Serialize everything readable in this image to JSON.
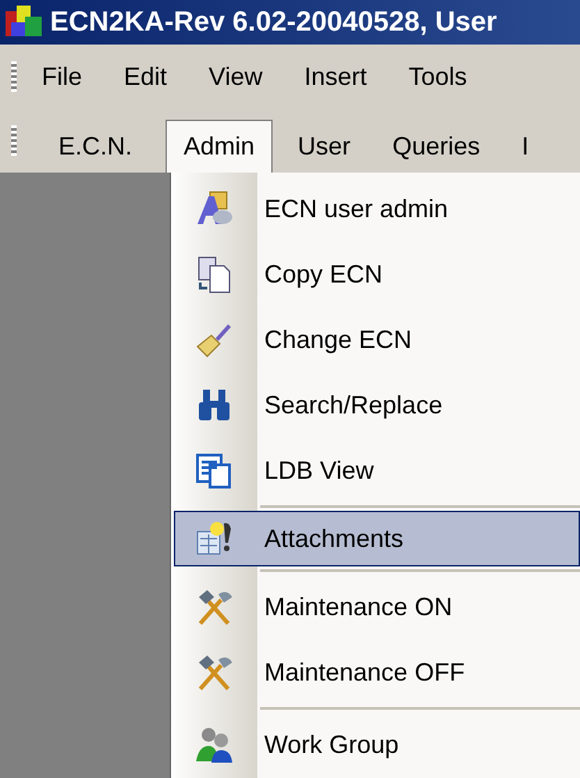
{
  "window": {
    "title": "ECN2KA-Rev 6.02-20040528, User"
  },
  "menu_bar": [
    "File",
    "Edit",
    "View",
    "Insert",
    "Tools"
  ],
  "toolbar": [
    {
      "label": "E.C.N.",
      "selected": false
    },
    {
      "label": "Admin",
      "selected": true
    },
    {
      "label": "User",
      "selected": false
    },
    {
      "label": "Queries",
      "selected": false
    },
    {
      "label": "I",
      "selected": false
    }
  ],
  "admin_menu": [
    {
      "kind": "command",
      "label": "ECN user admin",
      "selected": false
    },
    {
      "kind": "command",
      "label": "Copy ECN",
      "selected": false
    },
    {
      "kind": "command",
      "label": "Change ECN",
      "selected": false
    },
    {
      "kind": "command",
      "label": "Search/Replace",
      "selected": false
    },
    {
      "kind": "command",
      "label": "LDB View",
      "selected": false
    },
    {
      "kind": "separator"
    },
    {
      "kind": "command",
      "label": "Attachments",
      "selected": true
    },
    {
      "kind": "separator"
    },
    {
      "kind": "command",
      "label": "Maintenance ON",
      "selected": false
    },
    {
      "kind": "command",
      "label": "Maintenance OFF",
      "selected": false
    },
    {
      "kind": "separator"
    },
    {
      "kind": "command",
      "label": "Work Group",
      "selected": false
    }
  ]
}
